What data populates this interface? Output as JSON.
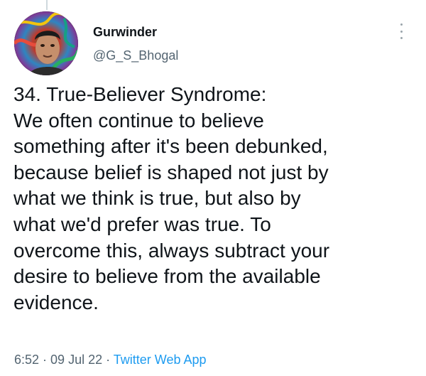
{
  "author": {
    "name": "Gurwinder",
    "handle": "@G_S_Bhogal"
  },
  "tweet": {
    "lines": [
      "34. True-Believer Syndrome:",
      "We often continue to believe",
      "something after it's been debunked,",
      "because belief is shaped not just by",
      "what we think is true, but also by",
      "what we'd prefer was true. To",
      "overcome this, always subtract your",
      "desire to believe from the available",
      "evidence."
    ]
  },
  "meta": {
    "time": "6:52",
    "separator": " · ",
    "date": "09 Jul 22",
    "source": "Twitter Web App"
  },
  "icons": {
    "more": "more-vertical-icon",
    "avatar": "profile-photo"
  },
  "colors": {
    "text": "#0f1419",
    "secondary": "#536471",
    "link": "#1d9bf0"
  }
}
